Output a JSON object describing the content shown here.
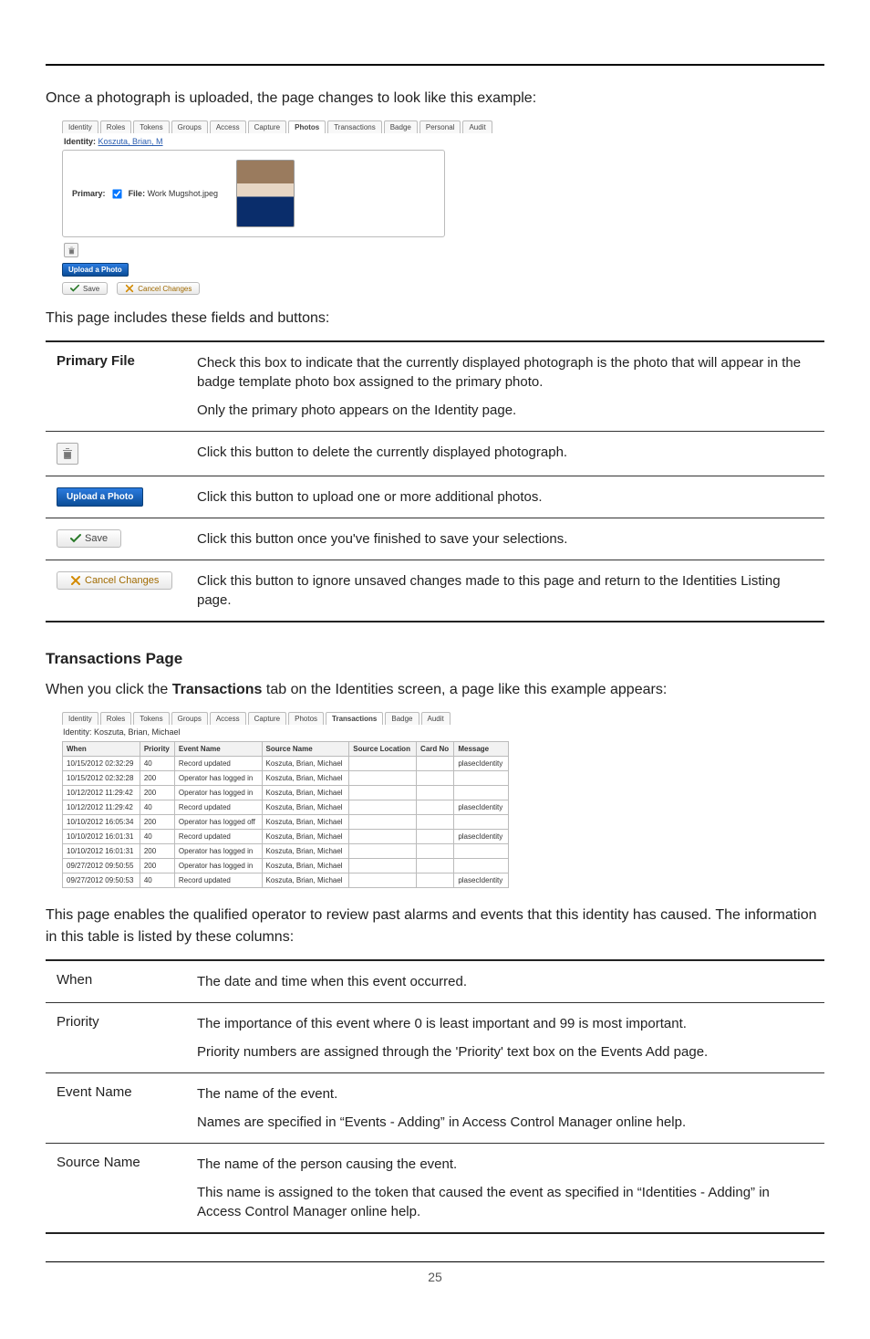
{
  "page_number": "25",
  "intro_text": "Once a photograph is uploaded, the page changes to look like this example:",
  "screenshot1": {
    "tabs": [
      "Identity",
      "Roles",
      "Tokens",
      "Groups",
      "Access",
      "Capture",
      "Photos",
      "Transactions",
      "Badge",
      "Personal",
      "Audit"
    ],
    "active_tab_index": 6,
    "identity_label": "Identity:",
    "identity_name": "Koszuta, Brian, M",
    "primary_label": "Primary:",
    "file_label": "File:",
    "file_name": "Work Mugshot.jpeg",
    "upload_label": "Upload a Photo",
    "save_label": "Save",
    "cancel_label": "Cancel Changes"
  },
  "fields_intro": "This page includes these fields and buttons:",
  "fields_table": {
    "primary_file_label": "Primary File",
    "primary_file_p1": "Check this box to indicate that the currently displayed photograph is the photo that will appear in the badge template photo box assigned to the primary photo.",
    "primary_file_p2": "Only the primary photo appears on the Identity page.",
    "trash_desc": "Click this button to delete the currently displayed photograph.",
    "upload_label": "Upload a Photo",
    "upload_desc": "Click this button to upload one or more additional photos.",
    "save_label": "Save",
    "save_desc": "Click this button once you've finished to save your selections.",
    "cancel_label": "Cancel Changes",
    "cancel_desc": "Click this button to ignore unsaved changes made to this page and return to the Identities Listing page."
  },
  "section_title": "Transactions Page",
  "tx_intro_pre": "When you click the ",
  "tx_intro_bold": "Transactions",
  "tx_intro_post": " tab on the Identities screen, a page like this example appears:",
  "screenshot2": {
    "tabs": [
      "Identity",
      "Roles",
      "Tokens",
      "Groups",
      "Access",
      "Capture",
      "Photos",
      "Transactions",
      "Badge",
      "Audit"
    ],
    "active_tab_index": 7,
    "identity_line": "Identity: Koszuta, Brian, Michael",
    "columns": [
      "When",
      "Priority",
      "Event Name",
      "Source Name",
      "Source Location",
      "Card No",
      "Message"
    ],
    "rows": [
      {
        "when": "10/15/2012 02:32:29",
        "priority": "40",
        "event": "Record updated",
        "source": "Koszuta, Brian, Michael",
        "loc": "",
        "card": "",
        "msg": "plasecIdentity"
      },
      {
        "when": "10/15/2012 02:32:28",
        "priority": "200",
        "event": "Operator has logged in",
        "source": "Koszuta, Brian, Michael",
        "loc": "",
        "card": "",
        "msg": ""
      },
      {
        "when": "10/12/2012 11:29:42",
        "priority": "200",
        "event": "Operator has logged in",
        "source": "Koszuta, Brian, Michael",
        "loc": "",
        "card": "",
        "msg": ""
      },
      {
        "when": "10/12/2012 11:29:42",
        "priority": "40",
        "event": "Record updated",
        "source": "Koszuta, Brian, Michael",
        "loc": "",
        "card": "",
        "msg": "plasecIdentity"
      },
      {
        "when": "10/10/2012 16:05:34",
        "priority": "200",
        "event": "Operator has logged off",
        "source": "Koszuta, Brian, Michael",
        "loc": "",
        "card": "",
        "msg": ""
      },
      {
        "when": "10/10/2012 16:01:31",
        "priority": "40",
        "event": "Record updated",
        "source": "Koszuta, Brian, Michael",
        "loc": "",
        "card": "",
        "msg": "plasecIdentity"
      },
      {
        "when": "10/10/2012 16:01:31",
        "priority": "200",
        "event": "Operator has logged in",
        "source": "Koszuta, Brian, Michael",
        "loc": "",
        "card": "",
        "msg": ""
      },
      {
        "when": "09/27/2012 09:50:55",
        "priority": "200",
        "event": "Operator has logged in",
        "source": "Koszuta, Brian, Michael",
        "loc": "",
        "card": "",
        "msg": ""
      },
      {
        "when": "09/27/2012 09:50:53",
        "priority": "40",
        "event": "Record updated",
        "source": "Koszuta, Brian, Michael",
        "loc": "",
        "card": "",
        "msg": "plasecIdentity"
      }
    ]
  },
  "tx_desc": "This page enables the qualified operator to review past alarms and events that this identity has caused. The information in this table is listed by these columns:",
  "tx_table": {
    "when_label": "When",
    "when_desc": "The date and time when this event occurred.",
    "priority_label": "Priority",
    "priority_p1": "The importance of this event where 0 is least important and 99 is most important.",
    "priority_p2": "Priority numbers are assigned through the 'Priority' text box on the Events Add page.",
    "event_label": "Event Name",
    "event_p1": "The name of the event.",
    "event_p2": "Names are specified in “Events - Adding” in Access Control Manager online help.",
    "source_label": "Source Name",
    "source_p1": "The name of the person causing the event.",
    "source_p2": "This name is assigned to the token that caused the event as specified in “Identities - Adding” in Access Control Manager online help."
  }
}
